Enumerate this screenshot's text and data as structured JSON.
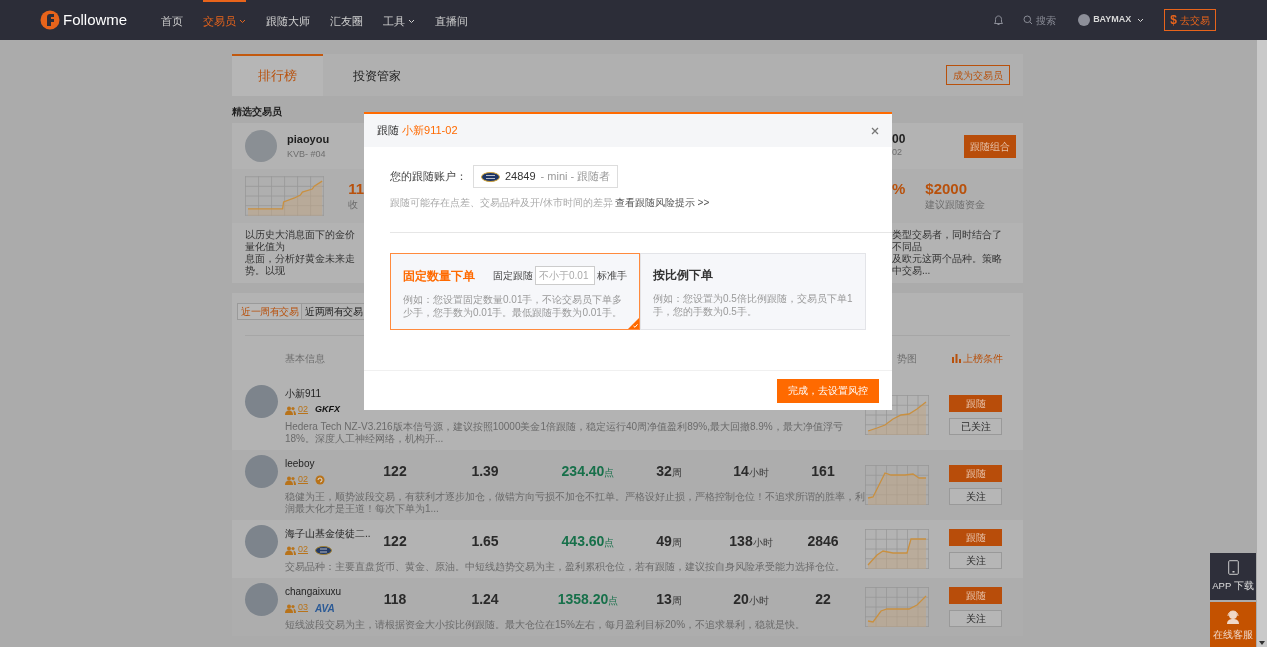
{
  "nav": {
    "logo": "Followme",
    "items": [
      {
        "label": "首页",
        "selected": false,
        "dropdown": false
      },
      {
        "label": "交易员",
        "selected": true,
        "dropdown": true
      },
      {
        "label": "跟随大师",
        "selected": false,
        "dropdown": false
      },
      {
        "label": "汇友圈",
        "selected": false,
        "dropdown": false
      },
      {
        "label": "工具",
        "selected": false,
        "dropdown": true
      },
      {
        "label": "直播间",
        "selected": false,
        "dropdown": false
      }
    ],
    "search_placeholder": "搜索",
    "user": "BAYMAX",
    "trade_symbol": "$",
    "trade_button": "去交易"
  },
  "tabs": [
    {
      "label": "排行榜",
      "selected": true
    },
    {
      "label": "投资管家",
      "selected": false
    }
  ],
  "become_trader": "成为交易员",
  "featured": {
    "heading": "精选交易员",
    "name": "piaoyou",
    "broker": "KVB- #04",
    "stat": "11",
    "stat_label": "收",
    "description": [
      "以历史大消息面下的金价量化值为",
      "息面，分析好黄金未来走势。以现"
    ],
    "right_stat": "00",
    "right_sub": "02",
    "percent": "%",
    "fund": "$2000",
    "fund_label": "建议跟随资金",
    "right_description": [
      "类型交易者，同时结合了不同品",
      "及欧元这两个品种。策略中交易..."
    ],
    "follow_button": "跟随组合"
  },
  "list": {
    "filters": [
      {
        "label": "近一周有交易",
        "selected": true
      },
      {
        "label": "近两周有交易",
        "selected": false
      }
    ],
    "columns": [
      "基本信息",
      "势图"
    ],
    "conditions": "上榜条件",
    "rows": [
      {
        "name": "小新911",
        "followers": "02",
        "broker": {
          "kind": "gkfx",
          "label": "GKFX"
        },
        "description": "Hedera Tech NZ-V3.216版本信号源，建议按照10000美金1倍跟随，稳定运行40周净值盈利89%,最大回撤8.9%，最大净值浮亏18%。深度人工神经网络，机构开...",
        "follow": "跟随",
        "watch": "已关注"
      },
      {
        "name": "leeboy",
        "followers": "02",
        "broker": {
          "kind": "circle"
        },
        "trades": "122",
        "ratio": "1.39",
        "points": "234.40",
        "points_unit": "点",
        "weeks": "32",
        "weeks_unit": "周",
        "hours": "14",
        "hours_unit": "小时",
        "count": "161",
        "description": "稳健为王，顺势波段交易，有获利才逐步加仓，做错方向亏损不加仓不扛单。严格设好止损，严格控制仓位！不追求所谓的胜率，利润最大化才是王道！每次下单为1...",
        "follow": "跟随",
        "watch": "关注"
      },
      {
        "name": "海子山基金使徒二..",
        "followers": "02",
        "broker": {
          "kind": "kvb"
        },
        "trades": "122",
        "ratio": "1.65",
        "points": "443.60",
        "points_unit": "点",
        "weeks": "49",
        "weeks_unit": "周",
        "hours": "138",
        "hours_unit": "小时",
        "count": "2846",
        "description": "交易品种：主要直盘货币、黄金、原油。中短线趋势交易为主，盈利累积仓位，若有跟随，建议按自身风险承受能力选择仓位。",
        "follow": "跟随",
        "watch": "关注"
      },
      {
        "name": "changaixuxu",
        "followers": "03",
        "broker": {
          "kind": "ava",
          "label": "AVA"
        },
        "trades": "118",
        "ratio": "1.24",
        "points": "1358.20",
        "points_unit": "点",
        "weeks": "13",
        "weeks_unit": "周",
        "hours": "20",
        "hours_unit": "小时",
        "count": "22",
        "description": "短线波段交易为主，请根据资金大小按比例跟随。最大仓位在15%左右，每月盈利目标20%，不追求暴利，稳就是快。",
        "follow": "跟随",
        "watch": "关注"
      }
    ]
  },
  "modal": {
    "title": "跟随",
    "trader": "小新911-02",
    "account_label": "您的跟随账户：",
    "account_number": "24849",
    "account_detail": "- mini - 跟随者",
    "hint": "跟随可能存在点差、交易品种及开/休市时间的差异",
    "risk_link": "查看跟随风险提示 >>",
    "options": [
      {
        "title": "固定数量下单",
        "selected": true,
        "field_label": "固定跟随",
        "placeholder": "不小于0.01",
        "unit": "标准手",
        "description": "例如：您设置固定数量0.01手，不论交易员下单多少手，您手数为0.01手。最低跟随手数为0.01手。"
      },
      {
        "title": "按比例下单",
        "selected": false,
        "description": "例如：您设置为0.5倍比例跟随，交易员下单1手，您的手数为0.5手。"
      }
    ],
    "confirm": "完成，去设置风控"
  },
  "floating": {
    "app": "APP 下载",
    "service": "在线客服"
  }
}
